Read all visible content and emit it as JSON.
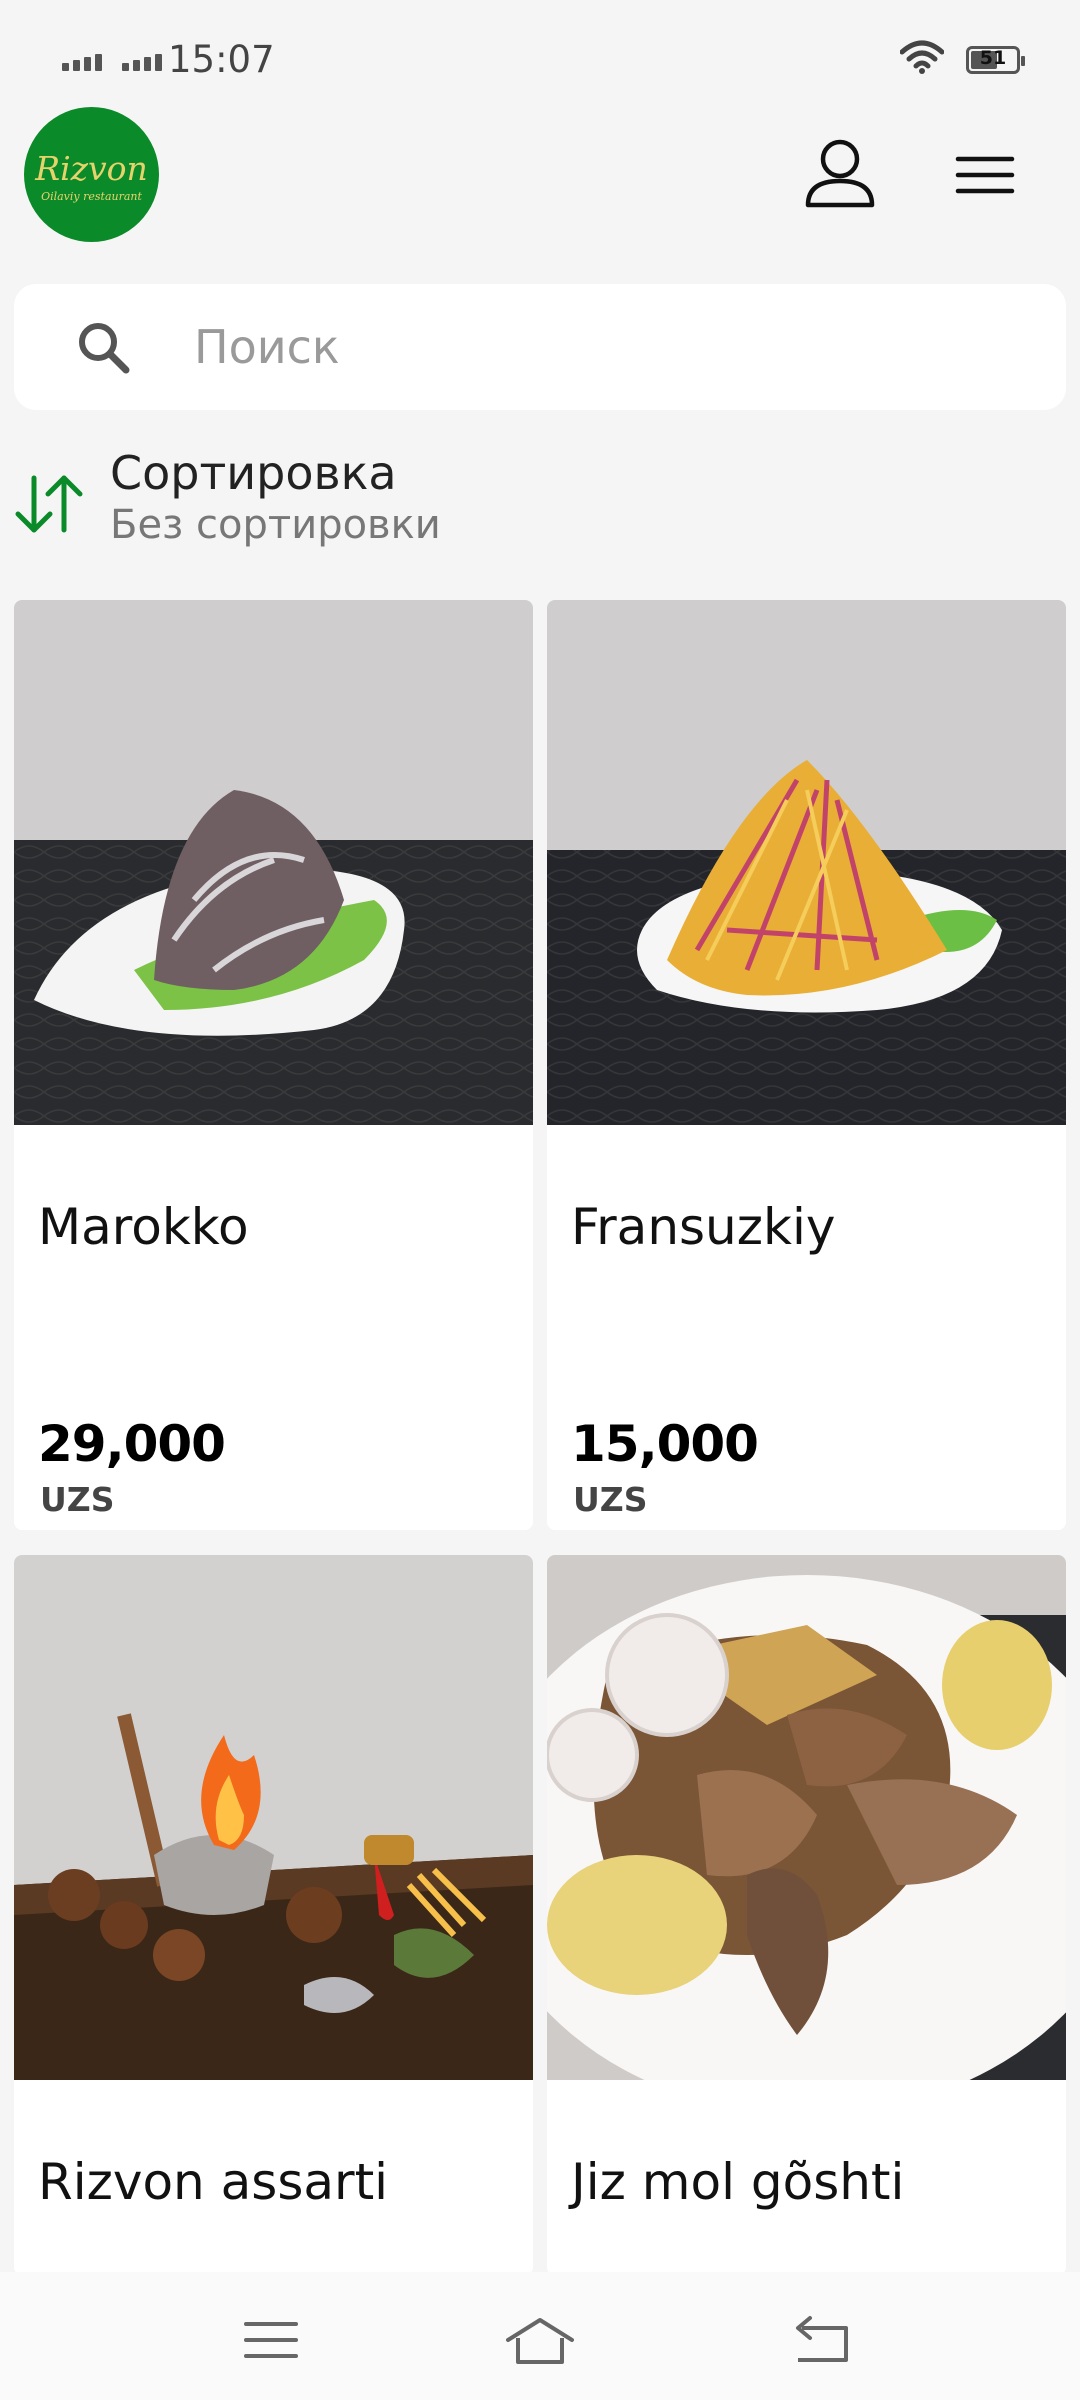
{
  "status_bar": {
    "time": "15:07",
    "battery": "51"
  },
  "header": {
    "logo_title": "Rizvon",
    "logo_subtitle": "Oilaviy restaurant"
  },
  "search": {
    "placeholder": "Поиск"
  },
  "sort": {
    "title": "Сортировка",
    "value": "Без сортировки"
  },
  "products": [
    {
      "name": "Marokko",
      "price": "29,000",
      "currency": "UZS"
    },
    {
      "name": "Fransuzkiy",
      "price": "15,000",
      "currency": "UZS"
    },
    {
      "name": "Rizvon assarti",
      "price": "",
      "currency": ""
    },
    {
      "name": "Jiz mol gõshti",
      "price": "",
      "currency": ""
    }
  ],
  "colors": {
    "brand_green": "#0b8a2a",
    "background": "#f5f5f5"
  },
  "icons": [
    "signal-icon",
    "wifi-icon",
    "battery-icon",
    "user-icon",
    "hamburger-menu-icon",
    "search-icon",
    "sort-arrows-icon",
    "nav-menu-icon",
    "nav-home-icon",
    "nav-back-icon"
  ]
}
